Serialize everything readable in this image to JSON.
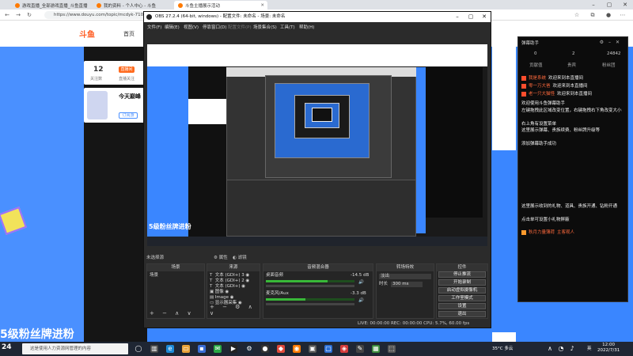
{
  "browser": {
    "tabs": [
      {
        "label": "游戏直播_全部游戏直播_斗鱼直播"
      },
      {
        "label": "我的资料 - 个人中心 - 斗鱼"
      },
      {
        "label": "斗鱼主播展示活动"
      }
    ],
    "url": "https://www.douyu.com/topic/mcdyk-7104a6"
  },
  "site": {
    "logo": "斗鱼",
    "home": "首页",
    "follow_count": "12",
    "follow_label": "关注数",
    "follow_button": "直播间",
    "follow_label2": "直播关注",
    "anchor_name": "今天巅峰",
    "anchor_button": "订阅游",
    "fan_banner": "5级粉丝牌进粉"
  },
  "chat": {
    "title": "弹幕助手",
    "stats": [
      "0",
      "2",
      "24842"
    ],
    "tabs": [
      "贡献值",
      "贵宾",
      "粉丝团"
    ],
    "messages": [
      {
        "user": "我是系统",
        "text": "欢迎来到本直播间"
      },
      {
        "user": "零一万大爸",
        "text": "欢迎来到本直播间"
      },
      {
        "user": "老一只大猫怪",
        "text": "欢迎来到本直播间"
      }
    ],
    "help_lines": [
      "欢迎使用斗鱼弹幕助手",
      "左键拖拽此区域改变位置，右键拖拽右下角改变大小",
      "右上角有设置菜单",
      "这里展示弹幕、贵族续费、粉丝牌升级等",
      "添加弹幕助手成功"
    ],
    "help_lines2": [
      "这里展示收到的礼物、道具、贵族开通、钻粉开通",
      "点击单可设置小礼物屏蔽"
    ],
    "gift_user": "秋月力量薄荷",
    "gift_text": "主客观人"
  },
  "obs": {
    "title": "OBS 27.2.4 (64-bit, windows) - 配置文件: 未命名 - 场景: 未命名",
    "menu": [
      "文件(F)",
      "编辑(E)",
      "视图(V)",
      "停靠窗口(D)",
      "配置文件(P)",
      "场景集合(S)",
      "工具(T)",
      "帮助(H)"
    ],
    "scene_bar": "未选择源",
    "properties_label": "属性",
    "filters_label": "滤镜",
    "preview_fan": "5级粉丝牌进粉",
    "docks": {
      "scenes": {
        "title": "场景",
        "items": [
          "场景"
        ]
      },
      "sources": {
        "title": "来源",
        "items": [
          {
            "icon": "T",
            "label": "文本 (GDI+) 3"
          },
          {
            "icon": "T",
            "label": "文本 (GDI+) 2"
          },
          {
            "icon": "T",
            "label": "文本 (GDI+)"
          },
          {
            "icon": "▣",
            "label": "图像"
          },
          {
            "icon": "▤",
            "label": "Image"
          },
          {
            "icon": "▭",
            "label": "显示器采集"
          }
        ]
      },
      "mixer": {
        "title": "音频混合器",
        "channels": [
          {
            "name": "桌面音频",
            "db": "-14.5 dB",
            "level": 0.7
          },
          {
            "name": "麦克风/Aux",
            "db": "-3.3 dB",
            "level": 0.45
          }
        ]
      },
      "transitions": {
        "title": "转场特效",
        "type": "淡出",
        "duration_label": "时长",
        "duration": "300 ms"
      },
      "controls": {
        "title": "控件",
        "buttons": [
          "停止推流",
          "开始录制",
          "启动虚拟摄像机",
          "工作室模式",
          "设置",
          "退出"
        ]
      }
    },
    "status": "LIVE: 00:00:00   REC: 00:00:00   CPU: 5.7%, 60.00 fps"
  },
  "taskbar": {
    "weather": "24",
    "search_placeholder": "这是使用人力资源网管理的内容",
    "temp": "35°C 多云",
    "lang": "英",
    "time": "12:00",
    "date": "2022/7/31"
  },
  "colors": {
    "accent": "#ff5d23",
    "site_blue": "#3a86ff",
    "obs_bg": "#2b2b2b",
    "chat_bg": "#0c0c0c"
  }
}
